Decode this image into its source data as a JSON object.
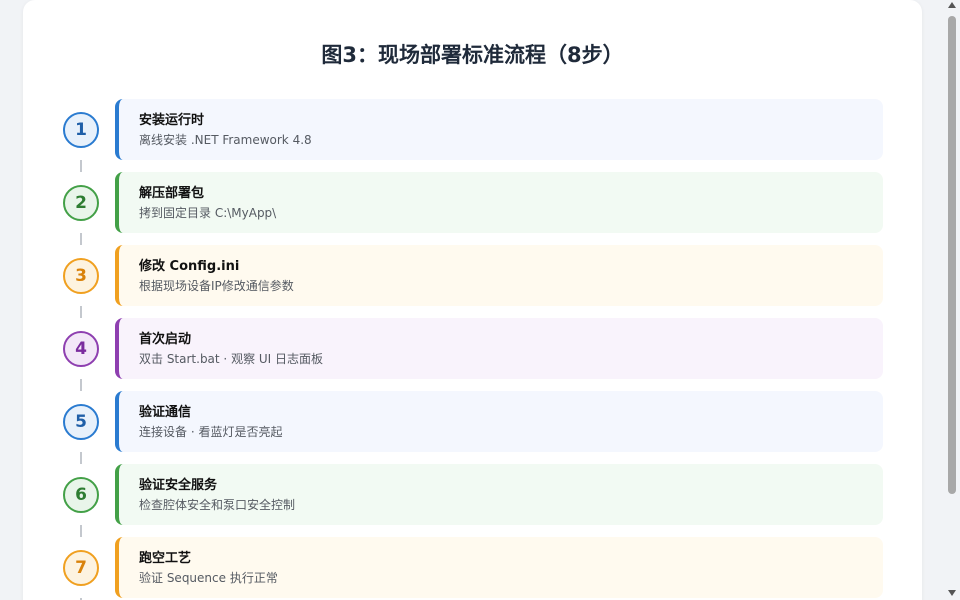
{
  "page": {
    "title": "图3：现场部署标准流程（8步）"
  },
  "steps": [
    {
      "number": "1",
      "title": "安装运行时",
      "desc": "离线安装 .NET Framework 4.8",
      "color": "#2a7bd0"
    },
    {
      "number": "2",
      "title": "解压部署包",
      "desc": "拷到固定目录 C:\\MyApp\\",
      "color": "#43a047"
    },
    {
      "number": "3",
      "title": "修改 Config.ini",
      "desc": "根据现场设备IP修改通信参数",
      "color": "#f0a020"
    },
    {
      "number": "4",
      "title": "首次启动",
      "desc": "双击 Start.bat · 观察 UI 日志面板",
      "color": "#8e3fb0"
    },
    {
      "number": "5",
      "title": "验证通信",
      "desc": "连接设备 · 看蓝灯是否亮起",
      "color": "#2a7bd0"
    },
    {
      "number": "6",
      "title": "验证安全服务",
      "desc": "检查腔体安全和泵口安全控制",
      "color": "#43a047"
    },
    {
      "number": "7",
      "title": "跑空工艺",
      "desc": "验证 Sequence 执行正常",
      "color": "#f0a020"
    }
  ]
}
